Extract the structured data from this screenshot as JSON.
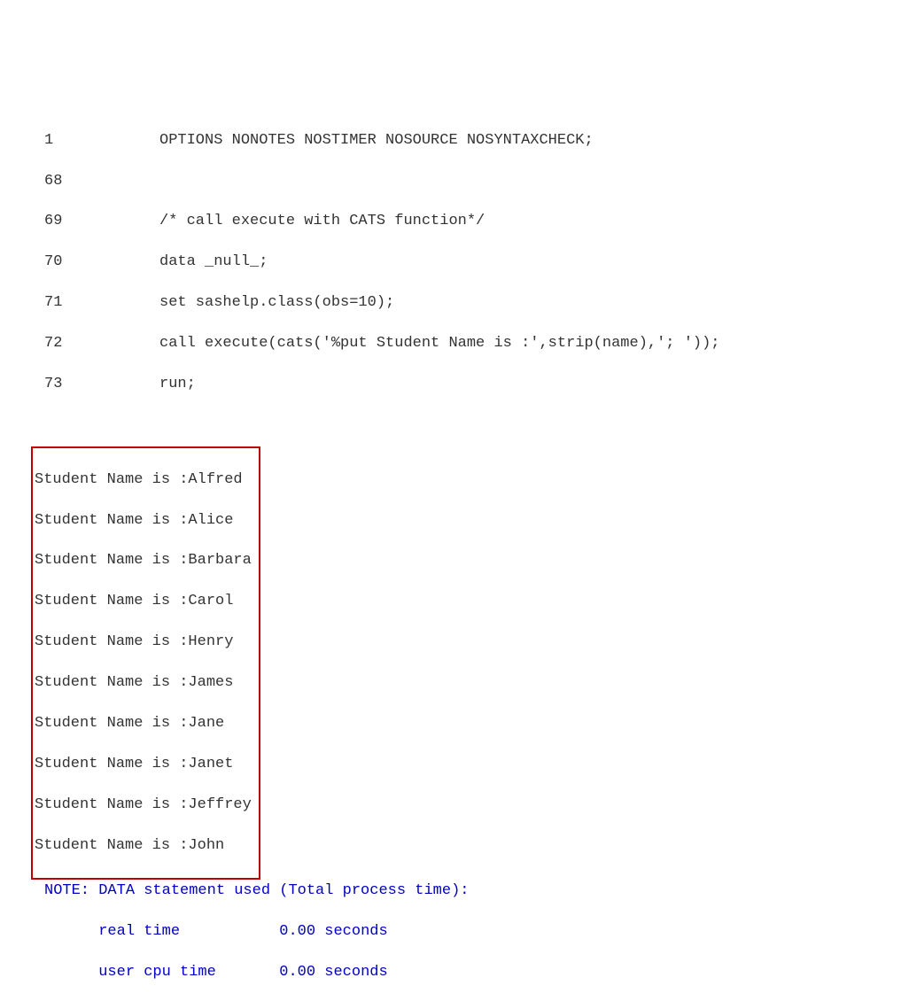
{
  "code": [
    {
      "lineno": "1",
      "text": "OPTIONS NONOTES NOSTIMER NOSOURCE NOSYNTAXCHECK;"
    },
    {
      "lineno": "68",
      "text": ""
    },
    {
      "lineno": "69",
      "text": "/* call execute with CATS function*/"
    },
    {
      "lineno": "70",
      "text": "data _null_;"
    },
    {
      "lineno": "71",
      "text": "set sashelp.class(obs=10);"
    },
    {
      "lineno": "72",
      "text": "call execute(cats('%put Student Name is :',strip(name),'; '));"
    },
    {
      "lineno": "73",
      "text": "run;"
    }
  ],
  "output": [
    "Student Name is :Alfred",
    "Student Name is :Alice",
    "Student Name is :Barbara",
    "Student Name is :Carol",
    "Student Name is :Henry",
    "Student Name is :James",
    "Student Name is :Jane",
    "Student Name is :Janet",
    "Student Name is :Jeffrey",
    "Student Name is :John"
  ],
  "note": "NOTE: DATA statement used (Total process time):",
  "timings": [
    {
      "label": "real time",
      "value": "0.00 seconds"
    },
    {
      "label": "user cpu time",
      "value": "0.00 seconds"
    }
  ]
}
